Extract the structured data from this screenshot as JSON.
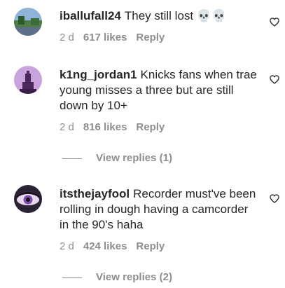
{
  "comments": [
    {
      "username": "iballufall24",
      "text": "They still lost 💀💀",
      "age": "2 d",
      "likes": "617 likes",
      "reply_label": "Reply",
      "avatar_icon": "avatar-landscape"
    },
    {
      "username": "k1ng_jordan1",
      "text": "Knicks fans when trae young misses a three but are still down by 10+",
      "age": "2 d",
      "likes": "816 likes",
      "reply_label": "Reply",
      "avatar_icon": "avatar-tower-silhouette",
      "view_replies": "View replies (1)"
    },
    {
      "username": "itsthejayfool",
      "text": "Recorder must've been rolling in dough having a camcorder in the 90's haha",
      "age": "2 d",
      "likes": "424 likes",
      "reply_label": "Reply",
      "avatar_icon": "avatar-eye-closeup",
      "view_replies": "View replies (2)"
    }
  ],
  "icons": {
    "like": "heart-outline-icon"
  },
  "colors": {
    "text": "#262626",
    "secondary": "#8e8e8e",
    "background": "#ffffff"
  }
}
